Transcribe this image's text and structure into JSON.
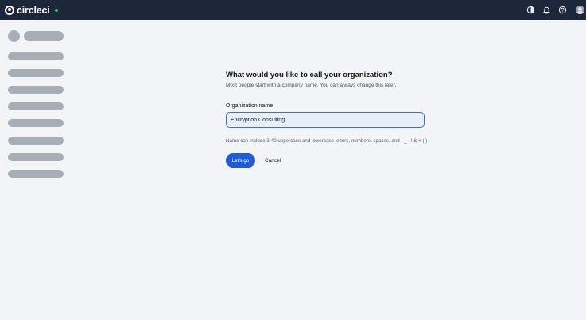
{
  "topbar": {
    "brand_name": "circleci",
    "icons": [
      "theme-toggle-icon",
      "bell-icon",
      "help-icon",
      "user-avatar"
    ],
    "bg_color": "#1c273a",
    "status_color": "#38c37c"
  },
  "sidebar": {
    "state": "loading-skeleton"
  },
  "form": {
    "title": "What would you like to call your organization?",
    "subtitle": "Most people start with a company name. You can always change this later.",
    "field_label": "Organization name",
    "field_value": "Encryption Consulting",
    "hint": "Name can include 3-40 uppercase and lowercase letters, numbers, spaces, and - _ . ! & + ( )",
    "primary_button": "Let's go",
    "secondary_button": "Cancel",
    "accent_color": "#1f5cd6"
  }
}
